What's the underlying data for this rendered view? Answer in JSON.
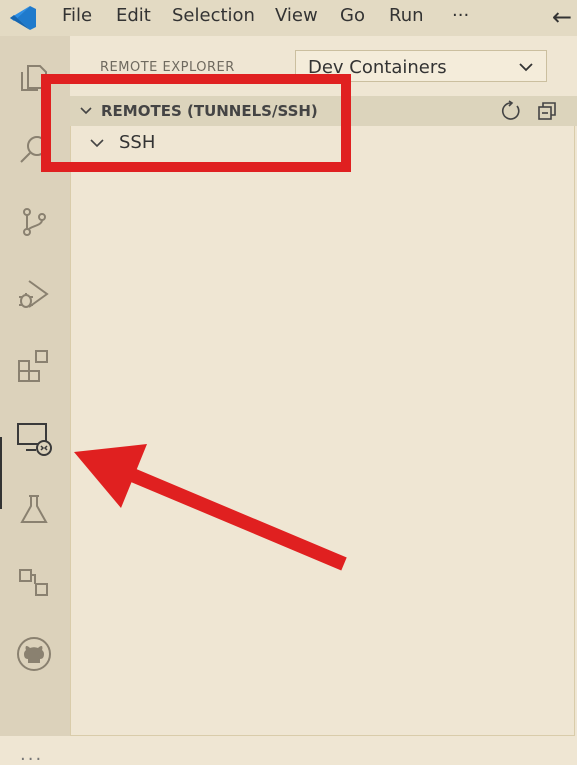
{
  "menu": {
    "file": "File",
    "edit": "Edit",
    "selection": "Selection",
    "view": "View",
    "go": "Go",
    "run": "Run",
    "more": "···"
  },
  "sidebar": {
    "title": "REMOTE EXPLORER",
    "dropdown_value": "Dev Containers",
    "section_label": "REMOTES (TUNNELS/SSH)",
    "tree_items": [
      {
        "label": "SSH"
      }
    ]
  },
  "activity_bar": {
    "icons": [
      "explorer-icon",
      "search-icon",
      "source-control-icon",
      "run-debug-icon",
      "extensions-icon",
      "remote-explorer-icon",
      "testing-icon",
      "remote-connections-icon",
      "github-icon"
    ],
    "more": "..."
  },
  "colors": {
    "accent_annotation": "#e02020",
    "vscode_blue": "#1f7acc"
  }
}
